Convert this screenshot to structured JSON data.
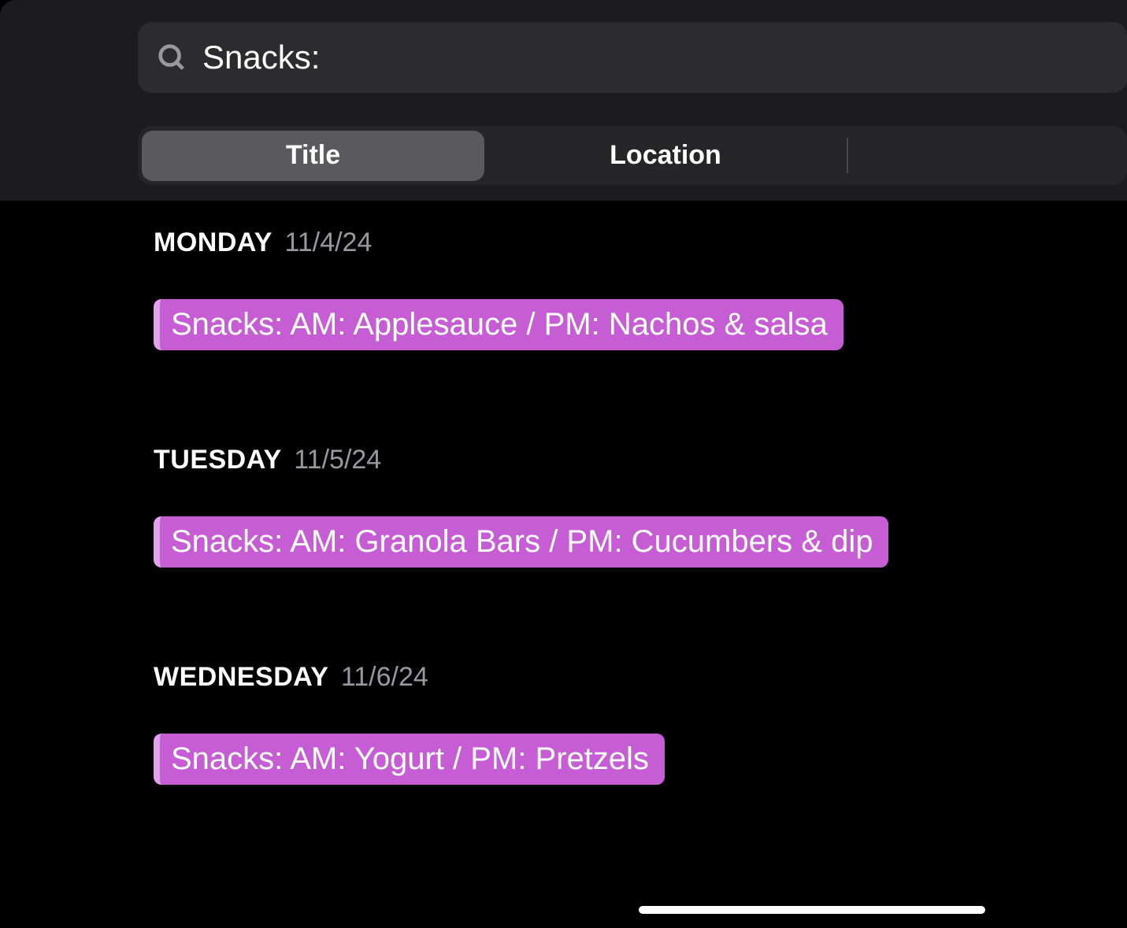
{
  "search": {
    "value": "Snacks:"
  },
  "tabs": {
    "title_label": "Title",
    "location_label": "Location"
  },
  "results": [
    {
      "day_name": "MONDAY",
      "date": "11/4/24",
      "event": "Snacks: AM: Applesauce / PM: Nachos & salsa"
    },
    {
      "day_name": "TUESDAY",
      "date": "11/5/24",
      "event": "Snacks: AM: Granola Bars / PM: Cucumbers & dip"
    },
    {
      "day_name": "WEDNESDAY",
      "date": "11/6/24",
      "event": "Snacks: AM: Yogurt / PM: Pretzels"
    }
  ],
  "colors": {
    "event_bg": "#c65dd4",
    "event_border": "#e3a0ec"
  }
}
